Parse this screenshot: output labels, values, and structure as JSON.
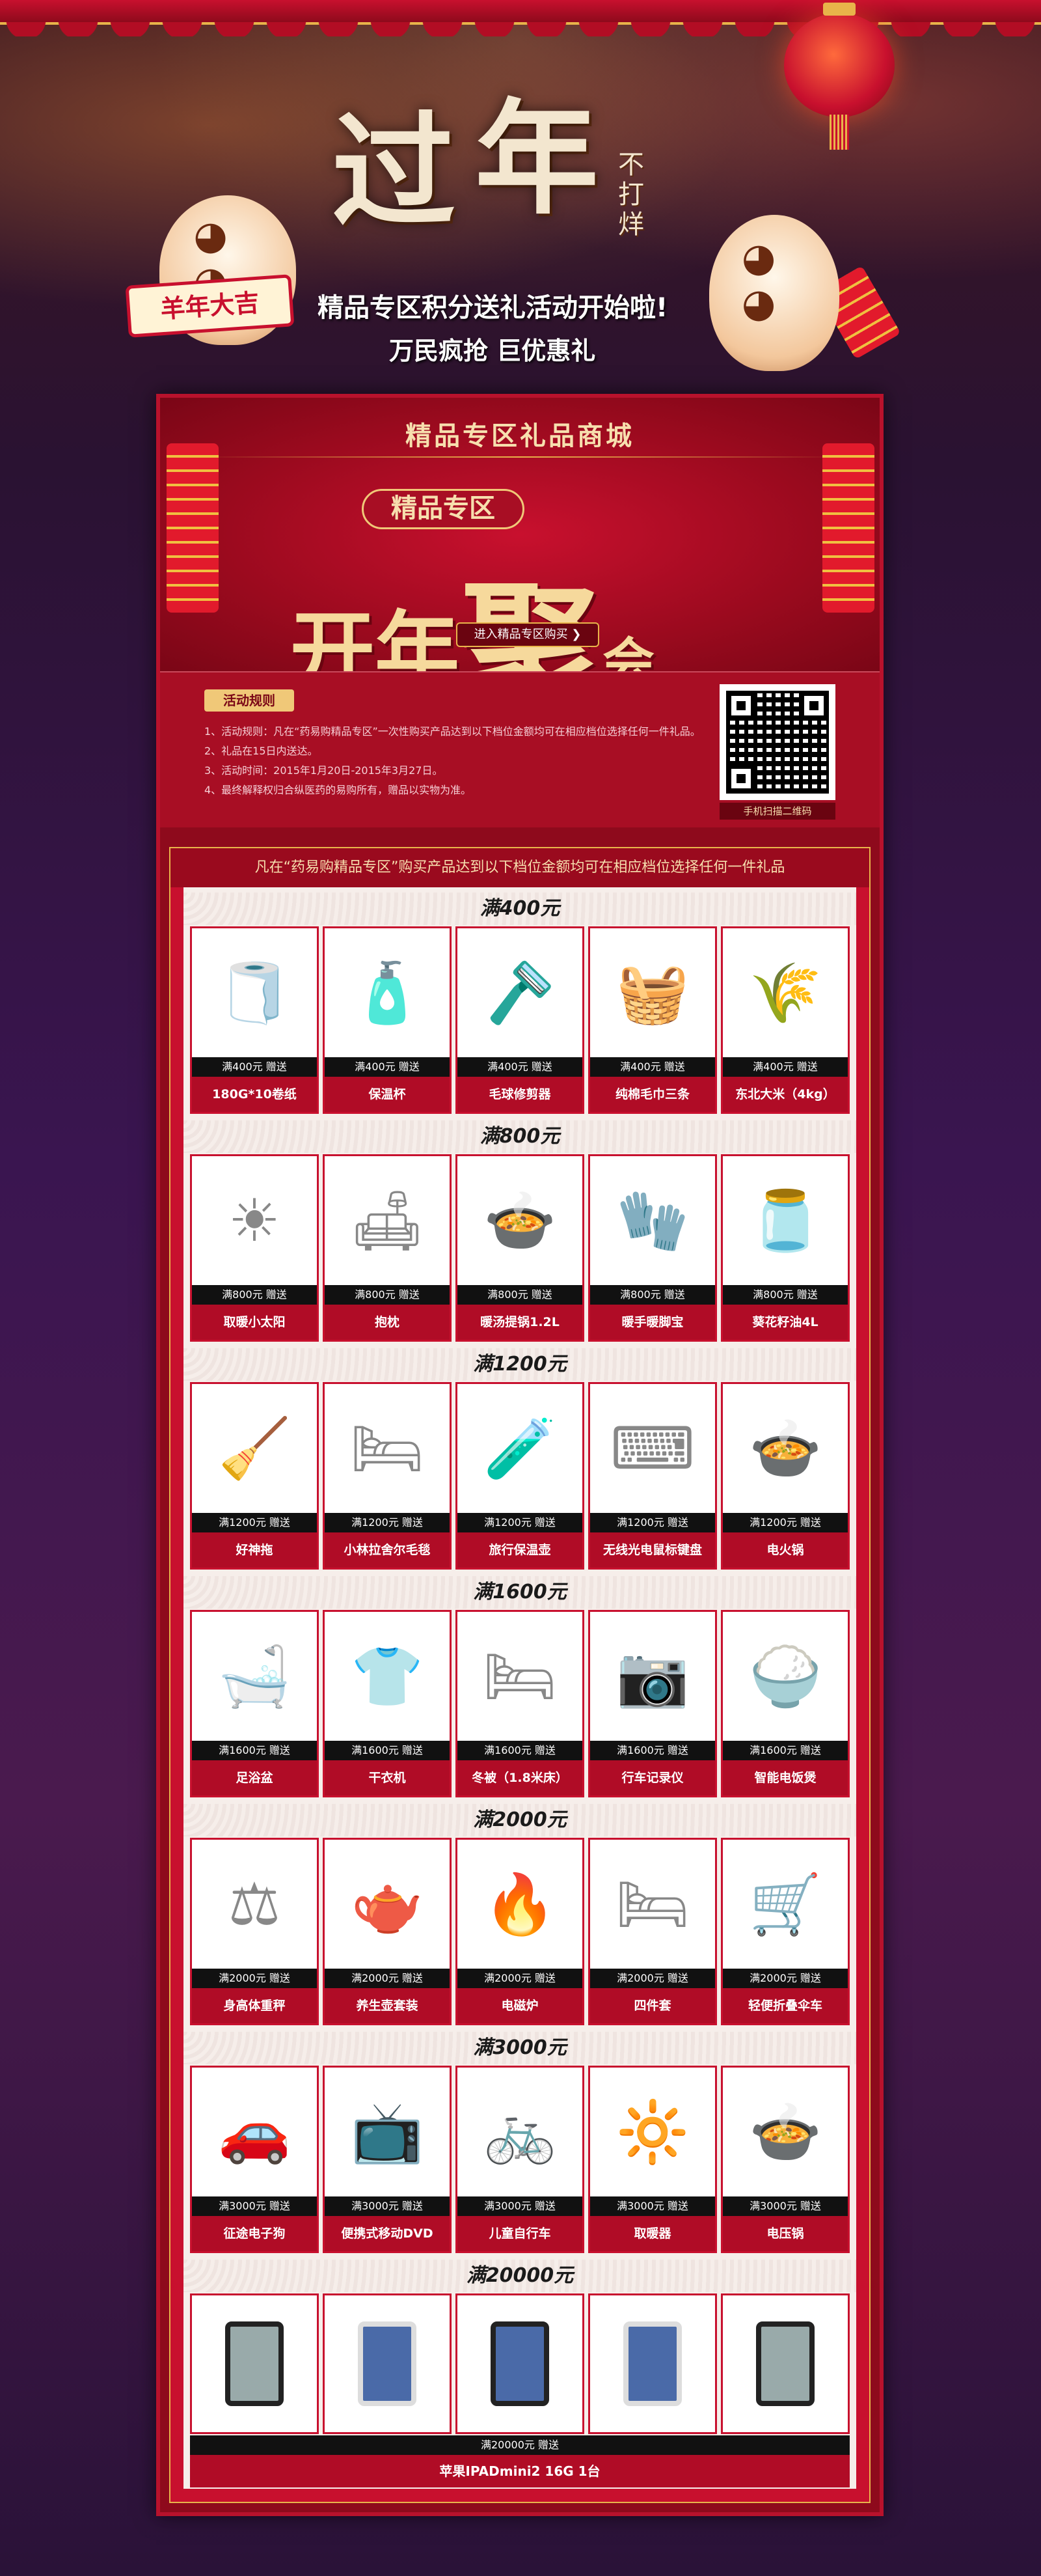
{
  "hero": {
    "title_char1": "过",
    "title_char2": "年",
    "title_small": "不打烊",
    "scroll_sign": "羊年大吉",
    "subtitle": "精品专区积分送礼活动开始啦!",
    "subtitle2": "万民疯抢 巨优惠礼"
  },
  "panel": {
    "mall_title": "精品专区礼品商城",
    "zone_badge": "精品专区",
    "big_title_a": "开年",
    "big_title_b": "聚",
    "big_title_c": "会",
    "enter_button": "进入精品专区购买 ❯"
  },
  "rules": {
    "tag": "活动规则",
    "items": [
      "1、活动规则：凡在“药易购精品专区”一次性购买产品达到以下档位金额均可在相应档位选择任何一件礼品。",
      "2、礼品在15日内送达。",
      "3、活动时间：2015年1月20日-2015年3月27日。",
      "4、最终解释权归合纵医药的易购所有，赠品以实物为准。"
    ],
    "qr_caption": "手机扫描二维码"
  },
  "gift_intro": "凡在“药易购精品专区”购买产品达到以下档位金额均可在相应档位选择任何一件礼品",
  "tiers": [
    {
      "title": "满400元",
      "price": "满400元  赠送",
      "items": [
        "180G*10卷纸",
        "保温杯",
        "毛球修剪器",
        "纯棉毛巾三条",
        "东北大米（4kg）"
      ]
    },
    {
      "title": "满800元",
      "price": "满800元  赠送",
      "items": [
        "取暖小太阳",
        "抱枕",
        "暖汤提锅1.2L",
        "暖手暖脚宝",
        "葵花籽油4L"
      ]
    },
    {
      "title": "满1200元",
      "price": "满1200元  赠送",
      "items": [
        "好神拖",
        "小林拉舍尔毛毯",
        "旅行保温壶",
        "无线光电鼠标键盘",
        "电火锅"
      ]
    },
    {
      "title": "满1600元",
      "price": "满1600元  赠送",
      "items": [
        "足浴盆",
        "干衣机",
        "冬被（1.8米床）",
        "行车记录仪",
        "智能电饭煲"
      ]
    },
    {
      "title": "满2000元",
      "price": "满2000元  赠送",
      "items": [
        "身高体重秤",
        "养生壶套装",
        "电磁炉",
        "四件套",
        "轻便折叠伞车"
      ]
    },
    {
      "title": "满3000元",
      "price": "满3000元  赠送",
      "items": [
        "征途电子狗",
        "便携式移动DVD",
        "儿童自行车",
        "取暖器",
        "电压锅"
      ]
    }
  ],
  "final_tier": {
    "title": "满20000元",
    "price": "满20000元  赠送",
    "name": "苹果IPADmini2 16G 1台"
  },
  "colors": {
    "primary_red": "#c8102e",
    "gold": "#e8b44a",
    "dark_red": "#8e0a1c"
  }
}
